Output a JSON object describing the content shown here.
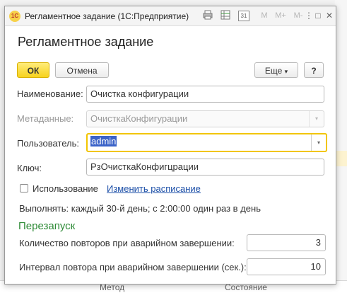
{
  "background": {
    "column_method": "Метод",
    "column_state": "Состояние"
  },
  "window": {
    "title": "Регламентное задание (1С:Предприятие)",
    "logo_text": "1C",
    "toolbar_icons": [
      "print-icon",
      "table-icon",
      "calendar-icon",
      "m-button",
      "m-plus-button",
      "m-minus-button",
      "more-button",
      "restore-button",
      "close-button"
    ],
    "calendar_number": "31",
    "memory_labels": {
      "m": "M",
      "m_plus": "M+",
      "m_minus": "M-"
    },
    "more_glyph": "⋮",
    "restore_glyph": "□",
    "close_glyph": "✕"
  },
  "form": {
    "title": "Регламентное задание",
    "buttons": {
      "ok": "ОК",
      "cancel": "Отмена",
      "more": "Еще",
      "more_arrow": "▾",
      "help": "?"
    },
    "name_label": "Наименование:",
    "name_value": "Очистка конфигурации",
    "metadata_label": "Метаданные:",
    "metadata_value": "ОчисткаКонфигурации",
    "user_label": "Пользователь:",
    "user_value": "admin",
    "dropdown_arrow": "▾",
    "key_label": "Ключ:",
    "key_value": "РзОчисткаКонфигцрации",
    "usage_label": "Использование",
    "usage_checked": false,
    "schedule_link": "Изменить расписание",
    "schedule_text": "Выполнять: каждый 30-й день; с 2:00:00 один раз в день",
    "restart_section": "Перезапуск",
    "retry_count_label": "Количество повторов при аварийном завершении:",
    "retry_count_value": "3",
    "retry_interval_label": "Интервал повтора при аварийном завершении (сек.):",
    "retry_interval_value": "10"
  },
  "colors": {
    "ok_button": "#f7d31e",
    "focus_border": "#f2c500",
    "link": "#1c4fa8",
    "section": "#2e8b37",
    "selection": "#3b63c8"
  }
}
